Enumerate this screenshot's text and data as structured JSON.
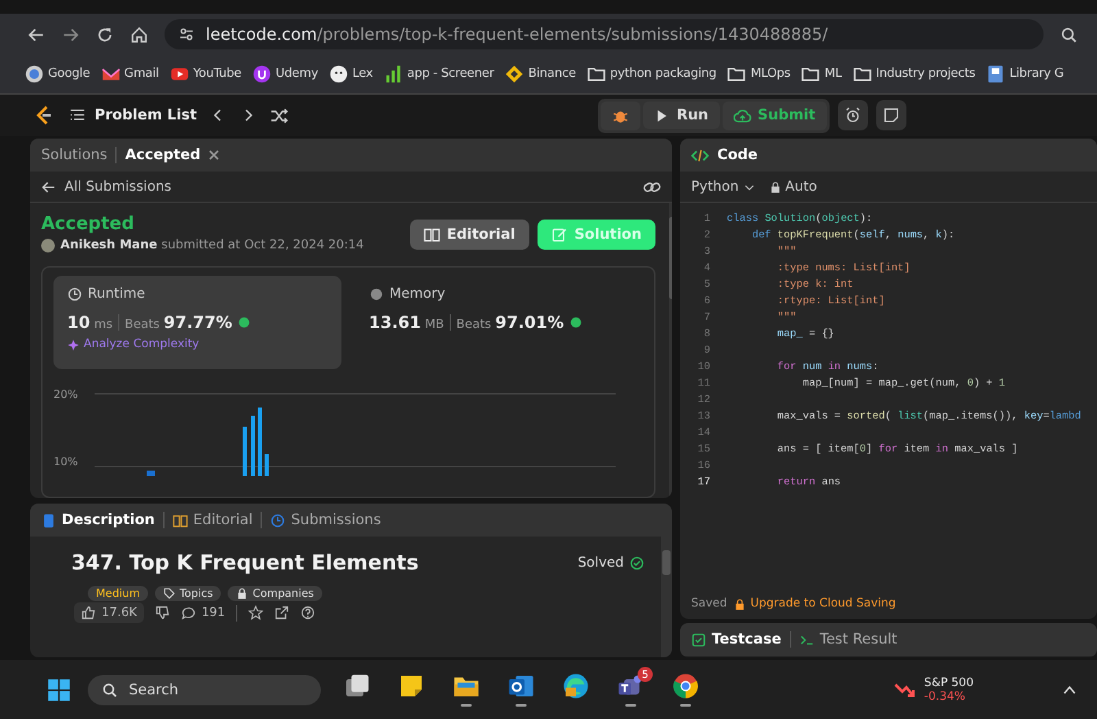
{
  "browser": {
    "url_host": "leetcode.com",
    "url_path": "/problems/top-k-frequent-elements/submissions/1430488885/"
  },
  "bookmarks": [
    {
      "label": "Google",
      "kind": "google"
    },
    {
      "label": "Gmail",
      "kind": "gmail"
    },
    {
      "label": "YouTube",
      "kind": "youtube"
    },
    {
      "label": "Udemy",
      "kind": "udemy"
    },
    {
      "label": "Lex",
      "kind": "lex"
    },
    {
      "label": "app - Screener",
      "kind": "screener"
    },
    {
      "label": "Binance",
      "kind": "binance"
    },
    {
      "label": "python packaging",
      "kind": "folder"
    },
    {
      "label": "MLOps",
      "kind": "folder"
    },
    {
      "label": "ML",
      "kind": "folder"
    },
    {
      "label": "Industry projects",
      "kind": "folder"
    },
    {
      "label": "Library G",
      "kind": "library"
    }
  ],
  "nav": {
    "problem_list": "Problem List",
    "run": "Run",
    "submit": "Submit"
  },
  "result_panel": {
    "tabs": [
      {
        "label": "Solutions",
        "selected": false,
        "closable": false
      },
      {
        "label": "Accepted",
        "selected": true,
        "closable": true
      }
    ],
    "back": "All Submissions",
    "status": "Accepted",
    "author": "Anikesh Mane",
    "submitted": "submitted at Oct 22, 2024 20:14",
    "buttons": [
      {
        "label": "Editorial",
        "kind": "secondary"
      },
      {
        "label": "Solution",
        "kind": "primary"
      }
    ],
    "metrics": [
      {
        "title": "Runtime",
        "kind": "time",
        "selected": true,
        "value": "10",
        "unit": "ms",
        "beats_label": "Beats",
        "beats": "97.77%",
        "link": "Analyze Complexity"
      },
      {
        "title": "Memory",
        "kind": "memory",
        "selected": false,
        "value": "13.61",
        "unit": "MB",
        "beats_label": "Beats",
        "beats": "97.01%"
      }
    ],
    "chart": {
      "y_labels": [
        "20%",
        "10%"
      ]
    }
  },
  "description_panel": {
    "tabs": [
      {
        "label": "Description",
        "kind": "description",
        "selected": true
      },
      {
        "label": "Editorial",
        "kind": "editorial",
        "selected": false
      },
      {
        "label": "Submissions",
        "kind": "submissions",
        "selected": false
      }
    ],
    "title": "347. Top K Frequent Elements",
    "status": "Solved",
    "tags": [
      {
        "label": "Medium",
        "kind": "difficulty"
      },
      {
        "label": "Topics",
        "kind": "topics"
      },
      {
        "label": "Companies",
        "kind": "companies"
      }
    ],
    "likes": "17.6K",
    "comments": "191"
  },
  "code_panel": {
    "title": "Code",
    "language": "Python",
    "mode": "Auto",
    "lines": [
      {
        "number": "1",
        "current": false,
        "tokens": [
          {
            "text": "class",
            "kind": "keyword"
          },
          {
            "text": " Solution",
            "kind": "class"
          },
          {
            "text": "(",
            "kind": "plain"
          },
          {
            "text": "object",
            "kind": "class"
          },
          {
            "text": "):",
            "kind": "plain"
          }
        ]
      },
      {
        "number": "2",
        "current": false,
        "tokens": [
          {
            "text": "    def",
            "kind": "keyword"
          },
          {
            "text": " topKFrequent",
            "kind": "function"
          },
          {
            "text": "(",
            "kind": "plain"
          },
          {
            "text": "self",
            "kind": "param"
          },
          {
            "text": ", ",
            "kind": "plain"
          },
          {
            "text": "nums",
            "kind": "param"
          },
          {
            "text": ", ",
            "kind": "plain"
          },
          {
            "text": "k",
            "kind": "param"
          },
          {
            "text": "):",
            "kind": "plain"
          }
        ]
      },
      {
        "number": "3",
        "current": false,
        "tokens": [
          {
            "text": "        \"\"\"",
            "kind": "string"
          }
        ]
      },
      {
        "number": "4",
        "current": false,
        "tokens": [
          {
            "text": "        :type nums: List[int]",
            "kind": "string"
          }
        ]
      },
      {
        "number": "5",
        "current": false,
        "tokens": [
          {
            "text": "        :type k: int",
            "kind": "string"
          }
        ]
      },
      {
        "number": "6",
        "current": false,
        "tokens": [
          {
            "text": "        :rtype: List[int]",
            "kind": "string"
          }
        ]
      },
      {
        "number": "7",
        "current": false,
        "tokens": [
          {
            "text": "        \"\"\"",
            "kind": "string"
          }
        ]
      },
      {
        "number": "8",
        "current": false,
        "tokens": [
          {
            "text": "        map_",
            "kind": "param"
          },
          {
            "text": " = {}",
            "kind": "plain"
          }
        ]
      },
      {
        "number": "9",
        "current": false
      },
      {
        "number": "10",
        "current": false,
        "tokens": [
          {
            "text": "        for",
            "kind": "control"
          },
          {
            "text": " num",
            "kind": "param"
          },
          {
            "text": " in",
            "kind": "control"
          },
          {
            "text": " nums",
            "kind": "param"
          },
          {
            "text": ":",
            "kind": "plain"
          }
        ]
      },
      {
        "number": "11",
        "current": false,
        "tokens": [
          {
            "text": "            map_[num] = map_.get(num, ",
            "kind": "plain"
          },
          {
            "text": "0",
            "kind": "number"
          },
          {
            "text": ") + ",
            "kind": "plain"
          },
          {
            "text": "1",
            "kind": "number"
          }
        ]
      },
      {
        "number": "12",
        "current": false
      },
      {
        "number": "13",
        "current": false,
        "tokens": [
          {
            "text": "        max_vals = ",
            "kind": "plain"
          },
          {
            "text": "sorted",
            "kind": "function"
          },
          {
            "text": "( ",
            "kind": "plain"
          },
          {
            "text": "list",
            "kind": "class"
          },
          {
            "text": "(map_.items()), ",
            "kind": "plain"
          },
          {
            "text": "key",
            "kind": "param"
          },
          {
            "text": "=",
            "kind": "plain"
          },
          {
            "text": "lambd",
            "kind": "keyword"
          }
        ]
      },
      {
        "number": "14",
        "current": false
      },
      {
        "number": "15",
        "current": false,
        "tokens": [
          {
            "text": "        ans = [ item[",
            "kind": "plain"
          },
          {
            "text": "0",
            "kind": "number"
          },
          {
            "text": "] ",
            "kind": "plain"
          },
          {
            "text": "for",
            "kind": "control"
          },
          {
            "text": " item ",
            "kind": "plain"
          },
          {
            "text": "in",
            "kind": "control"
          },
          {
            "text": " max_vals ]",
            "kind": "plain"
          }
        ]
      },
      {
        "number": "16",
        "current": false
      },
      {
        "number": "17",
        "current": true,
        "tokens": [
          {
            "text": "        return",
            "kind": "control"
          },
          {
            "text": " ans",
            "kind": "plain"
          }
        ]
      }
    ],
    "saved": "Saved",
    "upgrade": "Upgrade to Cloud Saving"
  },
  "console_tabs": [
    {
      "label": "Testcase",
      "kind": "testcase",
      "selected": true
    },
    {
      "label": "Test Result",
      "kind": "result",
      "selected": false
    }
  ],
  "taskbar": {
    "search_placeholder": "Search",
    "apps": [
      {
        "kind": "taskview",
        "running": false
      },
      {
        "kind": "notes",
        "running": false
      },
      {
        "kind": "explorer",
        "running": true
      },
      {
        "kind": "outlook",
        "running": true
      },
      {
        "kind": "edge",
        "running": false
      },
      {
        "kind": "teams",
        "running": true,
        "badge": "5"
      },
      {
        "kind": "chrome",
        "running": true
      }
    ],
    "widget": {
      "name": "S&P 500",
      "change": "-0.34%"
    }
  }
}
